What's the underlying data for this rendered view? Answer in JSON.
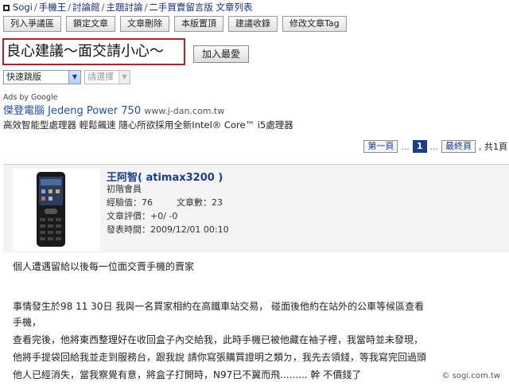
{
  "breadcrumb": {
    "items": [
      "Sogi",
      "手機王",
      "討論館",
      "主題討論",
      "二手買賣留言版"
    ],
    "current": "文章列表"
  },
  "toolbar": {
    "buttons": [
      "列入爭議區",
      "鎖定文章",
      "文章刪除",
      "本版置頂",
      "建議收錄",
      "修改文章Tag"
    ]
  },
  "thread": {
    "title": "良心建議～面交請小心～",
    "favorite_label": "加入最愛"
  },
  "selects": {
    "quick_jump": "快速跳版",
    "choose_placeholder": "請選擇"
  },
  "ad": {
    "ads_by": "Ads by Google",
    "title": "傑登電腦 Jedeng Power 750",
    "url": "www.j-dan.com.tw",
    "description": "高效智能型處理器 輕鬆飆速 隨心所欲採用全新Intel® Core™ i5處理器"
  },
  "pager": {
    "first": "第一頁",
    "dots": "...",
    "current_page": "1",
    "last": "最終頁",
    "total": ", 共1頁"
  },
  "post": {
    "author": "王阿智( atimax3200 )",
    "rank": "初階會員",
    "experience": "經驗值：76",
    "article_count": "文章數：23",
    "rating": "文章評價：+0/ -0",
    "published": "發表時間：2009/12/01 00:10",
    "lines": [
      "個人遭遇留給以後每一位面交賣手機的賣家",
      "事情發生於98  11 30日   我與一名買家相約在高鐵車站交易， 碰面後他約在站外的公車等候區查看",
      "手機，",
      "查看完後，他將東西整理好在收回盒子內交給我，此時手機已被他藏在袖子裡，我當時並未發現，",
      "他將手提袋回給我並走到服務台，跟我說  請你寫張購買證明之類ㄉ，我先去領錢，等我寫完回過頭",
      "他人已經消失，當我察覺有意，將盒子打開時，N97已不翼而飛.........  幹   不價錢了"
    ]
  },
  "watermark": "© sogi.com.tw"
}
